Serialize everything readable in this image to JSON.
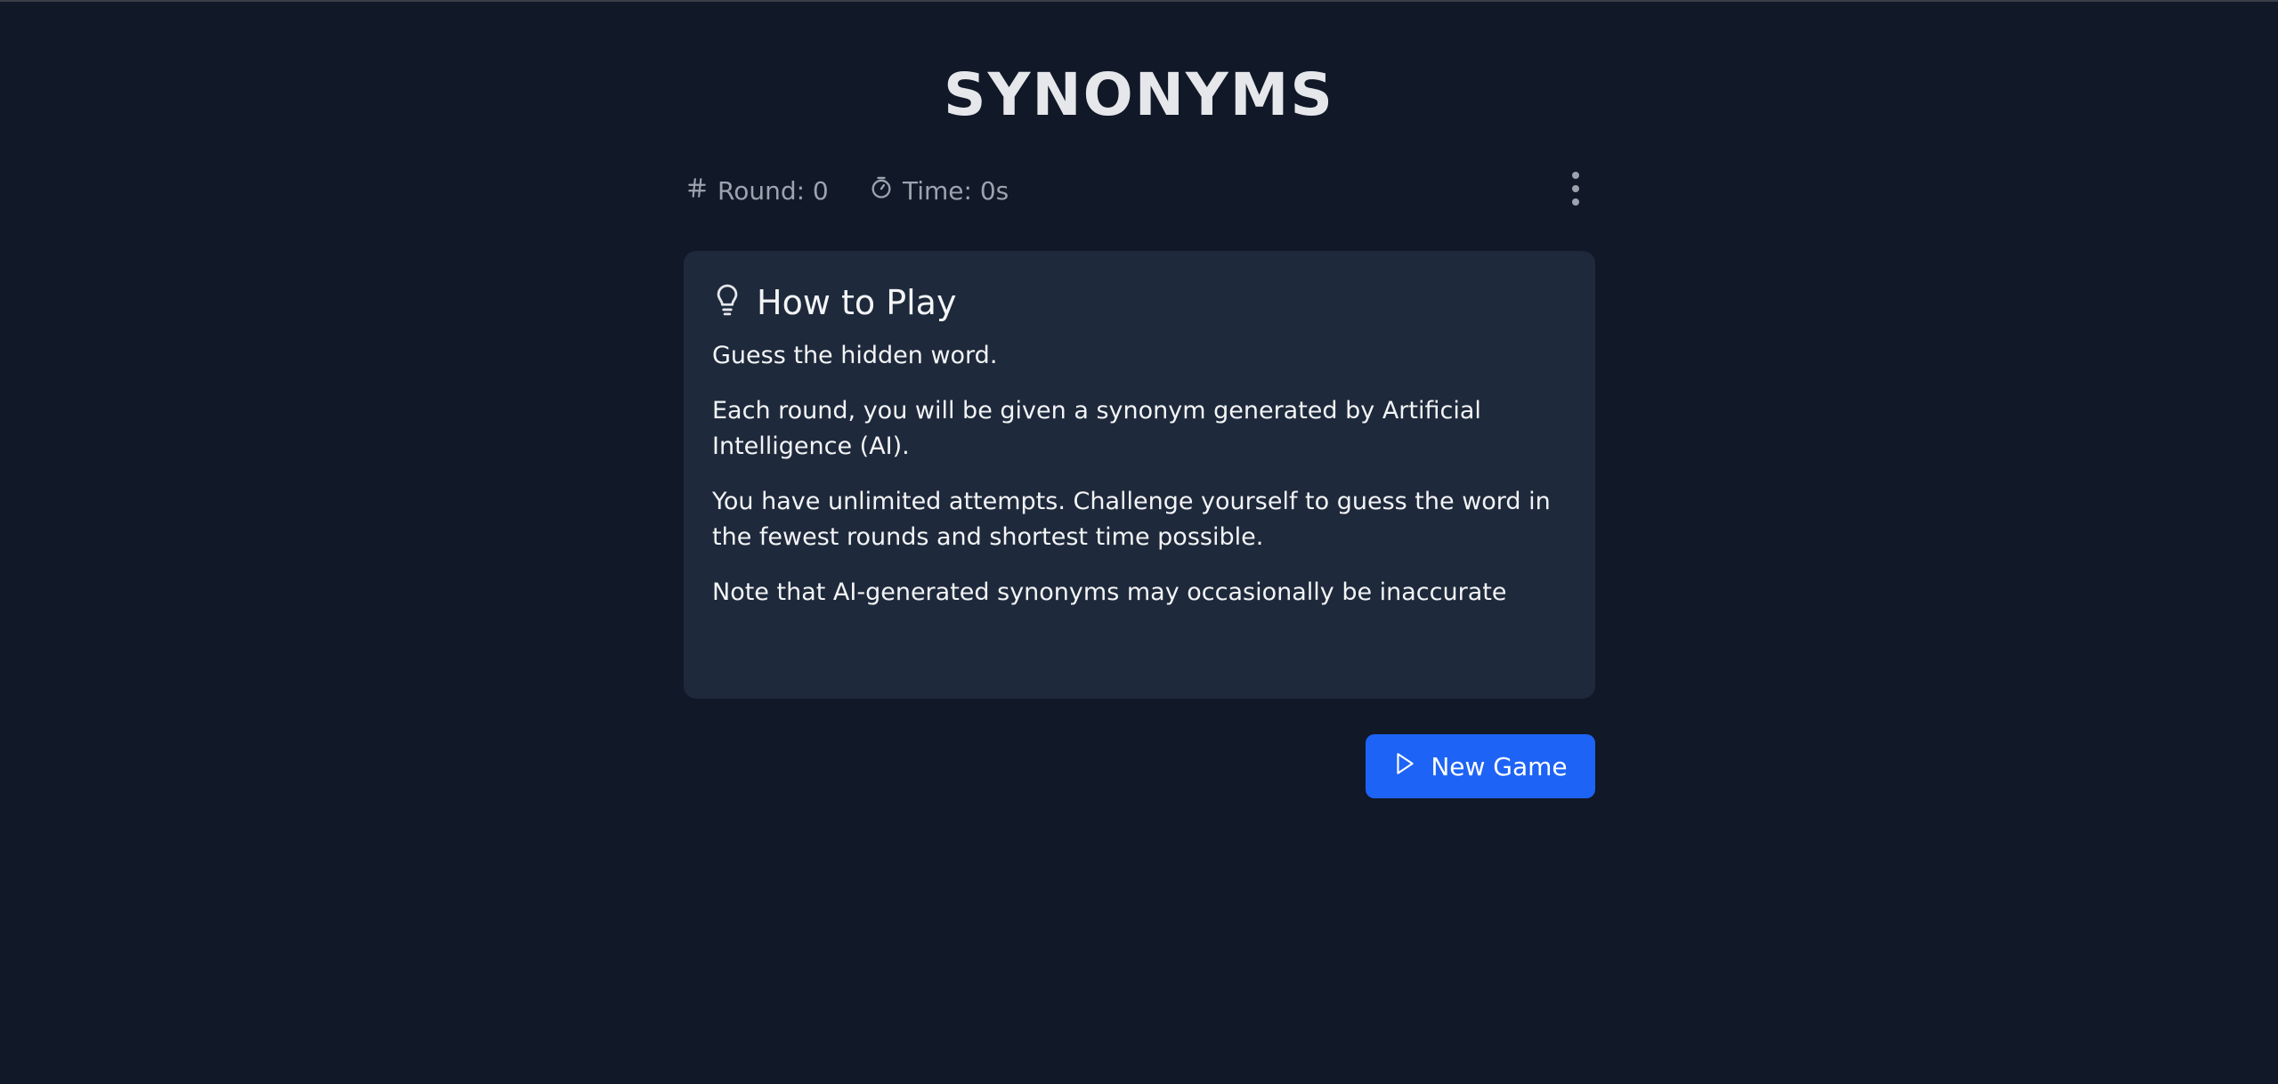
{
  "app": {
    "title": "SYNONYMS"
  },
  "stats": {
    "round_label": "Round: 0",
    "time_label": "Time: 0s",
    "round_icon": "hash-icon",
    "time_icon": "stopwatch-icon",
    "menu_icon": "more-vertical-icon"
  },
  "how_to_play": {
    "icon": "lightbulb-icon",
    "title": "How to Play",
    "paragraphs": [
      "Guess the hidden word.",
      "Each round, you will be given a synonym generated by Artificial Intelligence (AI).",
      "You have unlimited attempts. Challenge yourself to guess the word in the fewest rounds and shortest time possible.",
      "Note that AI-generated synonyms may occasionally be inaccurate"
    ]
  },
  "actions": {
    "new_game_label": "New Game",
    "new_game_icon": "play-icon"
  },
  "colors": {
    "background": "#111827",
    "card": "#1e293b",
    "accent": "#1d63f5",
    "muted_text": "#9ca3af",
    "text": "#f3f4f6"
  }
}
